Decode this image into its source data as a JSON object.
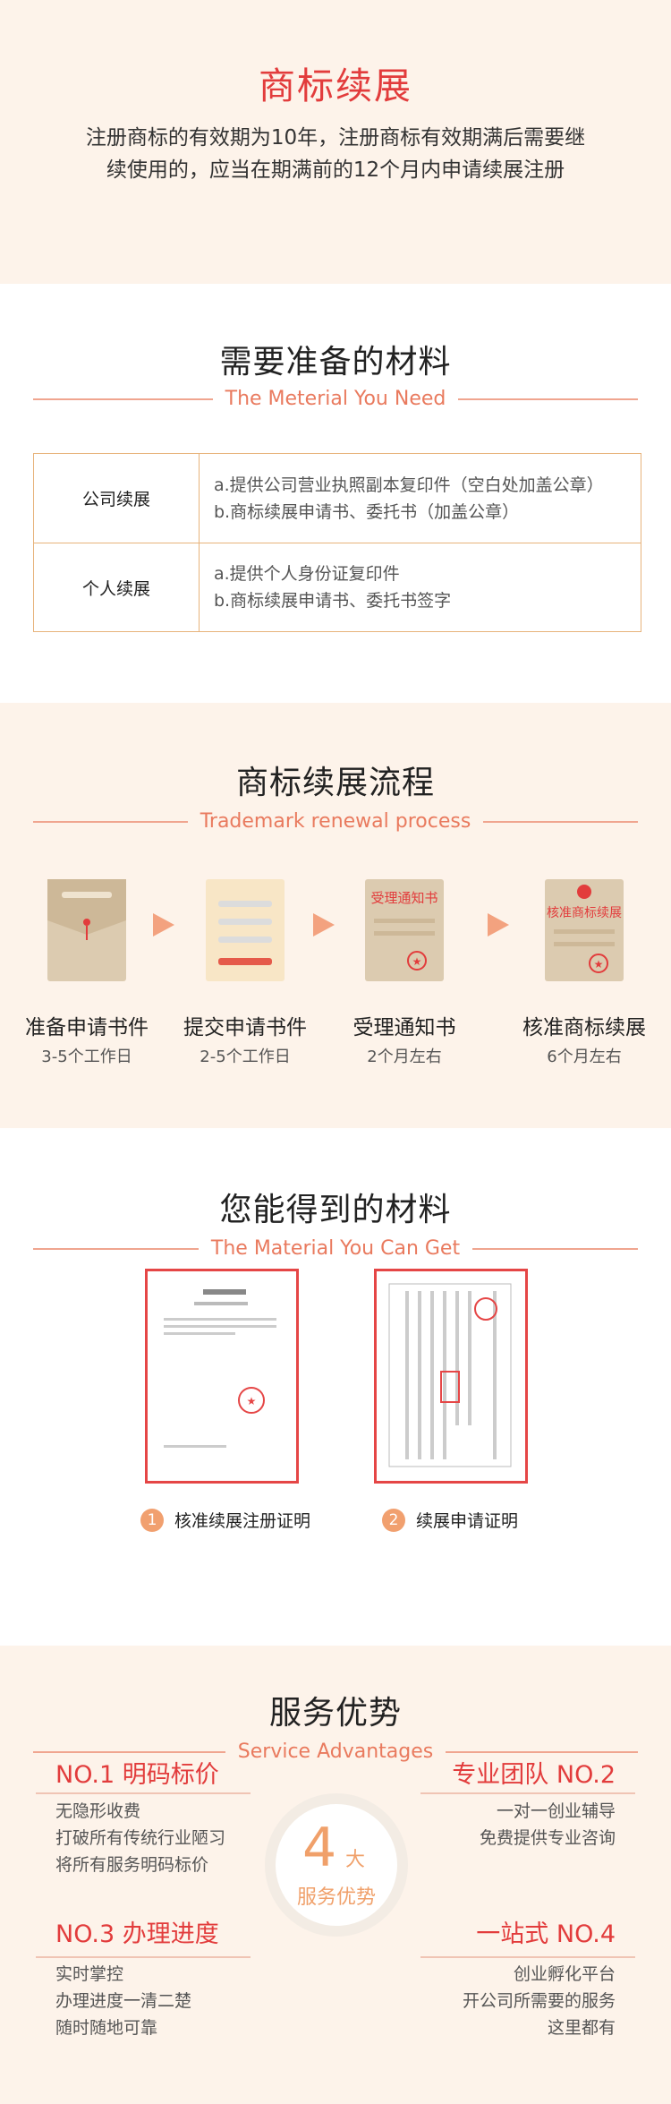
{
  "intro": {
    "title": "商标续展",
    "desc_line1": "注册商标的有效期为10年，注册商标有效期满后需要继",
    "desc_line2": "续使用的，应当在期满前的12个月内申请续展注册"
  },
  "materials": {
    "title": "需要准备的材料",
    "subtitle": "The Meterial You Need",
    "rows": [
      {
        "label": "公司续展",
        "items": [
          "a.提供公司营业执照副本复印件（空白处加盖公章）",
          "b.商标续展申请书、委托书（加盖公章）"
        ]
      },
      {
        "label": "个人续展",
        "items": [
          "a.提供个人身份证复印件",
          "b.商标续展申请书、委托书签字"
        ]
      }
    ]
  },
  "process": {
    "title": "商标续展流程",
    "subtitle": "Trademark renewal process",
    "steps": [
      {
        "name": "准备申请书件",
        "duration": "3-5个工作日",
        "icon": "envelope-icon"
      },
      {
        "name": "提交申请书件",
        "duration": "2-5个工作日",
        "icon": "document-icon"
      },
      {
        "name": "受理通知书",
        "duration": "2个月左右",
        "icon": "notice-icon",
        "icon_text": "受理通知书"
      },
      {
        "name": "核准商标续展",
        "duration": "6个月左右",
        "icon": "approval-icon",
        "icon_text": "核准商标续展"
      }
    ]
  },
  "results": {
    "title": "您能得到的材料",
    "subtitle": "The Material  You Can Get",
    "docs": [
      {
        "num": "1",
        "caption": "核准续展注册证明"
      },
      {
        "num": "2",
        "caption": "续展申请证明"
      }
    ]
  },
  "advantages": {
    "title": "服务优势",
    "subtitle": "Service Advantages",
    "badge": {
      "num": "4",
      "big": "大",
      "label": "服务优势"
    },
    "items": [
      {
        "title": "NO.1 明码标价",
        "lines": [
          "无隐形收费",
          "打破所有传统行业陋习",
          "将所有服务明码标价"
        ]
      },
      {
        "title": "专业团队 NO.2",
        "lines": [
          "一对一创业辅导",
          "免费提供专业咨询"
        ]
      },
      {
        "title": "NO.3 办理进度",
        "lines": [
          "实时掌控",
          "办理进度一清二楚",
          "随时随地可靠"
        ]
      },
      {
        "title": "一站式 NO.4",
        "lines": [
          "创业孵化平台",
          "开公司所需要的服务",
          "这里都有"
        ]
      }
    ]
  },
  "colors": {
    "accent": "#e23c3c",
    "orange": "#f0a06a",
    "beige": "#fdf3ea",
    "border": "#e7b37b"
  }
}
